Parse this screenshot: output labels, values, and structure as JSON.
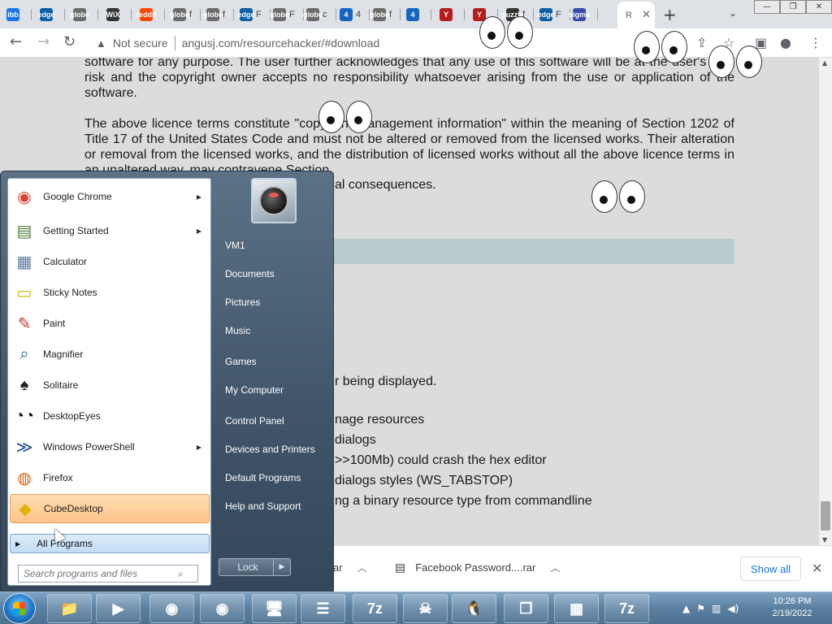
{
  "browser": {
    "tabs": [
      {
        "icon": "ibb",
        "color": "#1a73e8",
        "label": ""
      },
      {
        "icon": "edge",
        "color": "#0b5fa5",
        "label": ""
      },
      {
        "icon": "globe",
        "color": "#6b6b6b",
        "label": ""
      },
      {
        "icon": "WiX",
        "color": "#333333",
        "label": ""
      },
      {
        "icon": "reddit",
        "color": "#ff4500",
        "label": ""
      },
      {
        "icon": "globe",
        "color": "#6b6b6b",
        "label": "f"
      },
      {
        "icon": "globe",
        "color": "#6b6b6b",
        "label": "f"
      },
      {
        "icon": "edge",
        "color": "#0b5fa5",
        "label": "F"
      },
      {
        "icon": "globe",
        "color": "#6b6b6b",
        "label": "F"
      },
      {
        "icon": "globe",
        "color": "#6b6b6b",
        "label": "c"
      },
      {
        "icon": "4",
        "color": "#1565c0",
        "label": "4"
      },
      {
        "icon": "globe",
        "color": "#6b6b6b",
        "label": "f"
      },
      {
        "icon": "4",
        "color": "#1565c0",
        "label": ""
      },
      {
        "icon": "Y",
        "color": "#b71c1c",
        "label": ""
      },
      {
        "icon": "Y",
        "color": "#b71c1c",
        "label": ""
      },
      {
        "icon": "puzzle",
        "color": "#333333",
        "label": "f"
      },
      {
        "icon": "edge",
        "color": "#0b5fa5",
        "label": "F"
      },
      {
        "icon": "sigma",
        "color": "#3949ab",
        "label": ""
      }
    ],
    "active_tab_label": "R",
    "address": {
      "security": "Not secure",
      "url": "angusj.com/resourcehacker/#download"
    },
    "window_controls": [
      "—",
      "❐",
      "✕"
    ]
  },
  "page": {
    "para1": "software for any purpose. The user further acknowledges that any use of this software will be at the user's own risk and the copyright owner accepts no responsibility whatsoever arising from the use or application of the software.",
    "para2": "The above licence terms constitute \"copyright management information\" within the meaning of Section 1202 of Title 17 of the United States Code and must not be altered or removed from the licensed works. Their alteration or removal from the licensed works, and the distribution of licensed works without all the above licence terms in an unaltered way, may contravene Section",
    "para2_tail": "al consequences.",
    "changelog": [
      "r being displayed.",
      "nage resources",
      "dialogs",
      ">>100Mb) could crash the hex editor",
      "dialogs styles (WS_TABSTOP)",
      "ng a binary resource type from commandline"
    ]
  },
  "downloads": {
    "items": [
      {
        "name": "ar"
      },
      {
        "name": "Facebook Password....rar"
      }
    ],
    "show_all": "Show all"
  },
  "start_menu": {
    "programs": [
      {
        "name": "Google Chrome",
        "icon": "chrome-icon",
        "arrow": true
      },
      {
        "name": "Getting Started",
        "icon": "getting-started-icon",
        "arrow": true
      },
      {
        "name": "Calculator",
        "icon": "calculator-icon",
        "arrow": false
      },
      {
        "name": "Sticky Notes",
        "icon": "sticky-notes-icon",
        "arrow": false
      },
      {
        "name": "Paint",
        "icon": "paint-icon",
        "arrow": false
      },
      {
        "name": "Magnifier",
        "icon": "magnifier-icon",
        "arrow": false
      },
      {
        "name": "Solitaire",
        "icon": "solitaire-icon",
        "arrow": false
      },
      {
        "name": "DesktopEyes",
        "icon": "desktop-eyes-icon",
        "arrow": false
      },
      {
        "name": "Windows PowerShell",
        "icon": "powershell-icon",
        "arrow": true
      },
      {
        "name": "Firefox",
        "icon": "firefox-icon",
        "arrow": false
      },
      {
        "name": "CubeDesktop",
        "icon": "cubedesktop-icon",
        "arrow": false,
        "highlighted": true
      }
    ],
    "all_programs": "All Programs",
    "search_placeholder": "Search programs and files",
    "right_links": [
      "VM1",
      "Documents",
      "Pictures",
      "Music",
      "Games",
      "My Computer",
      "Control Panel",
      "Devices and Printers",
      "Default Programs",
      "Help and Support"
    ],
    "lock": "Lock"
  },
  "taskbar": {
    "apps": [
      "file-explorer-icon",
      "media-player-icon",
      "chrome-icon",
      "firefox-icon",
      "network-icon",
      "list-icon",
      "7zip-icon",
      "pirate-icon",
      "penguin-icon",
      "window-icon",
      "game-icon",
      "7zip-icon"
    ],
    "app_glyphs": [
      "📁",
      "▶",
      "◉",
      "◉",
      "🖥",
      "☰",
      "7z",
      "☠",
      "🐧",
      "❐",
      "▦",
      "7z"
    ],
    "clock_time": "10:26 PM",
    "clock_date": "2/19/2022"
  }
}
